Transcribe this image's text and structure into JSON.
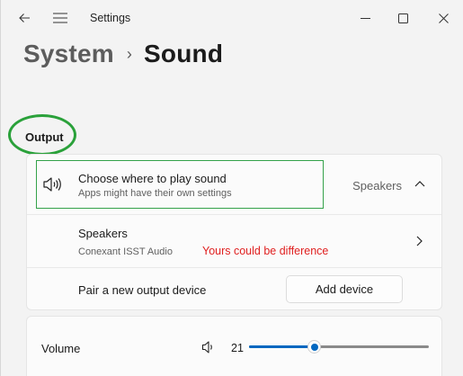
{
  "titlebar": {
    "title": "Settings",
    "icons": [
      "back-arrow-icon",
      "hamburger-menu-icon",
      "minimize-icon",
      "maximize-icon",
      "close-icon"
    ]
  },
  "breadcrumb": {
    "parent": "System",
    "separator": "›",
    "current": "Sound"
  },
  "output": {
    "label": "Output",
    "choose": {
      "title": "Choose where to play sound",
      "subtitle": "Apps might have their own settings",
      "value": "Speakers",
      "icon": "speaker-icon"
    },
    "speakers": {
      "title": "Speakers",
      "subtitle": "Conexant ISST Audio",
      "annotation": "Yours could be difference"
    },
    "pair": {
      "title": "Pair a new output device",
      "button_label": "Add device"
    }
  },
  "volume": {
    "label": "Volume",
    "value": "21",
    "level": 0.21,
    "icon": "volume-icon"
  },
  "colors": {
    "accent": "#0067c0",
    "annotation_green": "#2aa13a",
    "annotation_red": "#e02020",
    "background": "#f3f3f3",
    "card": "#fbfbfb"
  }
}
